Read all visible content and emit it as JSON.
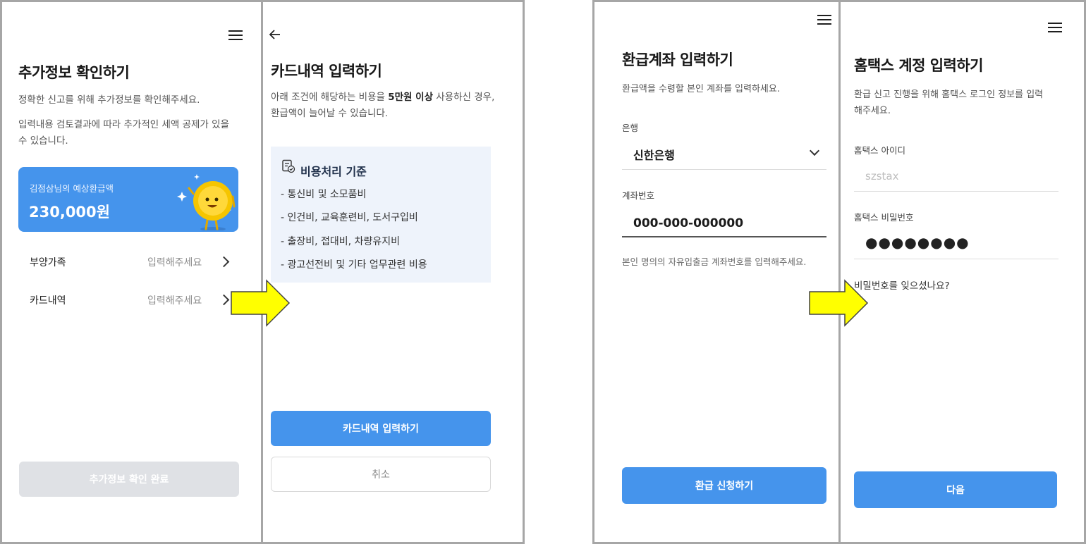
{
  "s1": {
    "title": "추가정보 확인하기",
    "desc1": "정확한 신고를 위해 추가정보를 확인해주세요.",
    "desc2": "입력내용 검토결과에 따라 추가적인 세액 공제가 있을 수 있습니다.",
    "card_caption": "김점삼님의 예상환급액",
    "card_amount": "230,000원",
    "rows": [
      {
        "label": "부양가족",
        "hint": "입력해주세요"
      },
      {
        "label": "카드내역",
        "hint": "입력해주세요"
      }
    ],
    "confirm_button": "추가정보 확인 완료"
  },
  "s2": {
    "title": "카드내역 입력하기",
    "desc_pre": "아래 조건에 해당하는 비용을 ",
    "desc_bold": "5만원 이상",
    "desc_post": " 사용하신 경우, 환급액이 늘어날 수 있습니다.",
    "criteria_title": "비용처리 기준",
    "criteria_items": [
      "- 통신비 및 소모품비",
      "- 인건비, 교육훈련비, 도서구입비",
      "- 출장비, 접대비, 차량유지비",
      "- 광고선전비 및 기타 업무관련 비용"
    ],
    "primary_button": "카드내역 입력하기",
    "cancel_button": "취소"
  },
  "s3": {
    "title": "환급계좌 입력하기",
    "desc": "환급액을 수령할 본인 계좌를 입력하세요.",
    "bank_label": "은행",
    "bank_value": "신한은행",
    "account_label": "계좌번호",
    "account_value": "000-000-000000",
    "account_hint": "본인 명의의 자유입출금 계좌번호를 입력해주세요.",
    "submit_button": "환급 신청하기"
  },
  "s4": {
    "title": "홈택스 계정 입력하기",
    "desc": "환급 신고 진행을 위해 홈택스 로그인 정보를 입력해주세요.",
    "id_label": "홈택스 아이디",
    "id_placeholder": "szstax",
    "pw_label": "홈택스 비밀번호",
    "pw_value": "●●●●●●●●",
    "forgot_link": "비밀번호를 잊으셨나요?",
    "next_button": "다음"
  },
  "colors": {
    "primary": "#4594ec",
    "disabled": "#dfe1e5",
    "arrow": "#ffff00",
    "criteria_bg": "#eef3fb"
  },
  "icons": [
    "menu-icon",
    "back-icon",
    "chevron-right-icon",
    "chevron-down-icon",
    "document-check-icon",
    "coin-character-icon",
    "sparkle-icon",
    "arrow-right-icon"
  ]
}
